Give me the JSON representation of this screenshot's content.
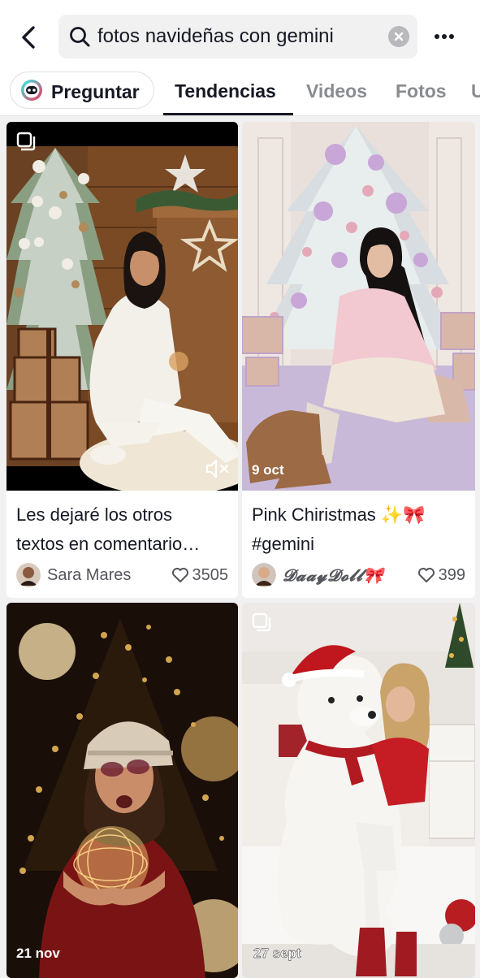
{
  "header": {
    "back_icon": "chevron-left-icon",
    "search_query": "fotos navideñas con gemini",
    "search_icon": "search-icon",
    "clear_icon": "clear-icon",
    "more_icon": "more-icon"
  },
  "tabs": {
    "ask_label": "Preguntar",
    "items": [
      {
        "label": "Tendencias",
        "active": true
      },
      {
        "label": "Videos",
        "active": false
      },
      {
        "label": "Fotos",
        "active": false
      },
      {
        "label": "U",
        "active": false
      }
    ]
  },
  "results": [
    {
      "caption_line1": "Les dejaré los otros",
      "caption_line2": "textos en comentario…",
      "author": "Sara Mares",
      "likes": "3505",
      "date": "",
      "muted": true
    },
    {
      "caption_line1": "Pink Chiristmas ✨🎀",
      "caption_line2": "#gemini",
      "author": "𝓓𝓪𝓪𝔂𝓓𝓸𝓵𝓵🎀",
      "likes": "399",
      "date": "9 oct"
    },
    {
      "date": "21 nov"
    },
    {
      "date": "27 sept"
    }
  ],
  "colors": {
    "accent_text": "#161823",
    "muted_text": "#8a8b91",
    "background": "#f1f1f2"
  }
}
